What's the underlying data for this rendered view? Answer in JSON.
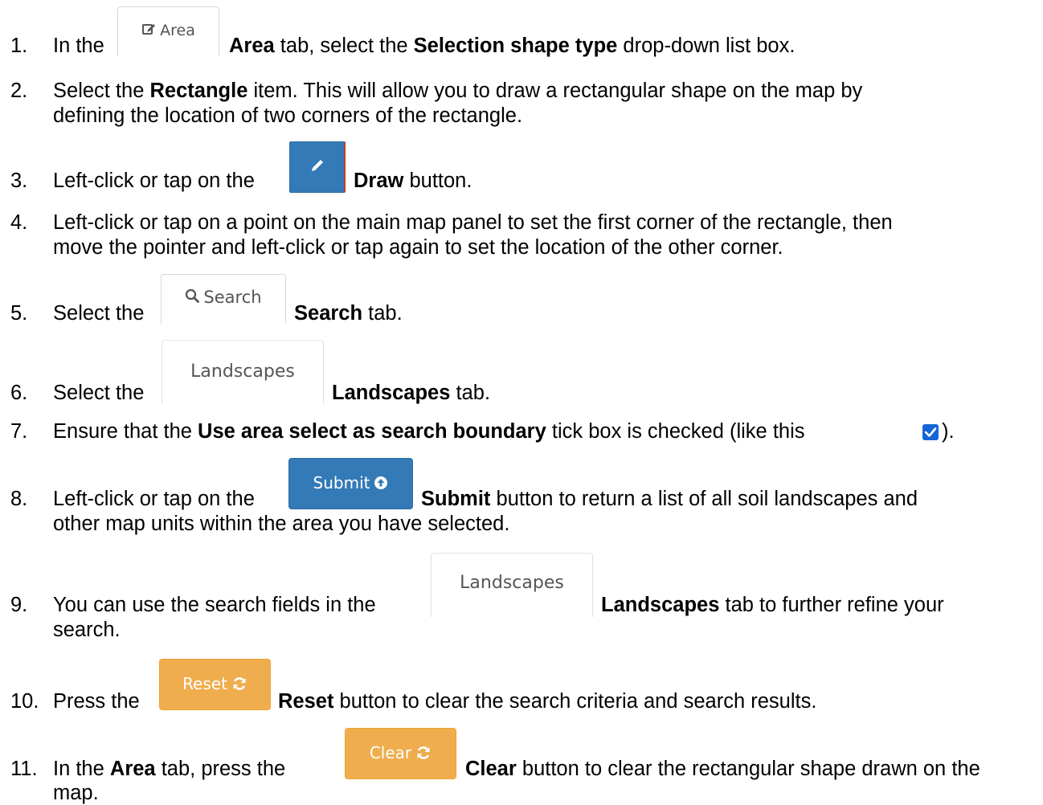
{
  "steps": [
    {
      "num": "1.",
      "parts": [
        "In the",
        "Area",
        "tab, select the",
        "Selection shape type",
        "drop-down list box."
      ]
    },
    {
      "num": "2.",
      "parts": [
        "Select the",
        "Rectangle",
        "item. This will allow you to draw a rectangular shape on the map by",
        "defining the location of two corners of the rectangle."
      ]
    },
    {
      "num": "3.",
      "parts": [
        "Left-click or tap on the",
        "Draw",
        "button."
      ]
    },
    {
      "num": "4.",
      "parts": [
        "Left-click or tap on a point on the main map panel to set the first corner of the rectangle, then",
        "move the pointer and left-click or tap again to set the location of the other corner."
      ]
    },
    {
      "num": "5.",
      "parts": [
        "Select the",
        "Search",
        "tab."
      ]
    },
    {
      "num": "6.",
      "parts": [
        "Select the",
        "Landscapes",
        "tab."
      ]
    },
    {
      "num": "7.",
      "parts": [
        "Ensure that the",
        "Use area select as search boundary",
        "tick box is checked (like this",
        ")."
      ]
    },
    {
      "num": "8.",
      "parts": [
        "Left-click or tap on the",
        "Submit",
        "button to return a list of all soil landscapes and",
        "other map units within the area you have selected."
      ]
    },
    {
      "num": "9.",
      "parts": [
        "You can use the search fields in the",
        "Landscapes",
        "tab to further refine your",
        "search."
      ]
    },
    {
      "num": "10.",
      "parts": [
        "Press the",
        "Reset",
        "button to clear the search criteria and search results."
      ]
    },
    {
      "num": "11.",
      "parts": [
        "In the",
        "Area",
        "tab, press the",
        "Clear",
        "button to clear the rectangular shape drawn on the",
        "map."
      ]
    }
  ],
  "ui_images": {
    "area_tab": {
      "label": "Area",
      "icon": "edit-icon"
    },
    "draw_button": {
      "icon": "pencil-icon",
      "color": "#337ab7"
    },
    "search_tab": {
      "label": "Search",
      "icon": "search-icon"
    },
    "landscapes_tab": {
      "label": "Landscapes"
    },
    "submit_button": {
      "label": "Submit",
      "icon": "circle-arrow-up-icon",
      "color": "#337ab7"
    },
    "reset_button": {
      "label": "Reset",
      "icon": "refresh-icon",
      "color": "#f0ad4e"
    },
    "clear_button": {
      "label": "Clear",
      "icon": "refresh-icon",
      "color": "#f0ad4e"
    },
    "checkbox": {
      "icon": "checked-checkbox-icon",
      "checked": true,
      "color": "#1565d8"
    }
  }
}
